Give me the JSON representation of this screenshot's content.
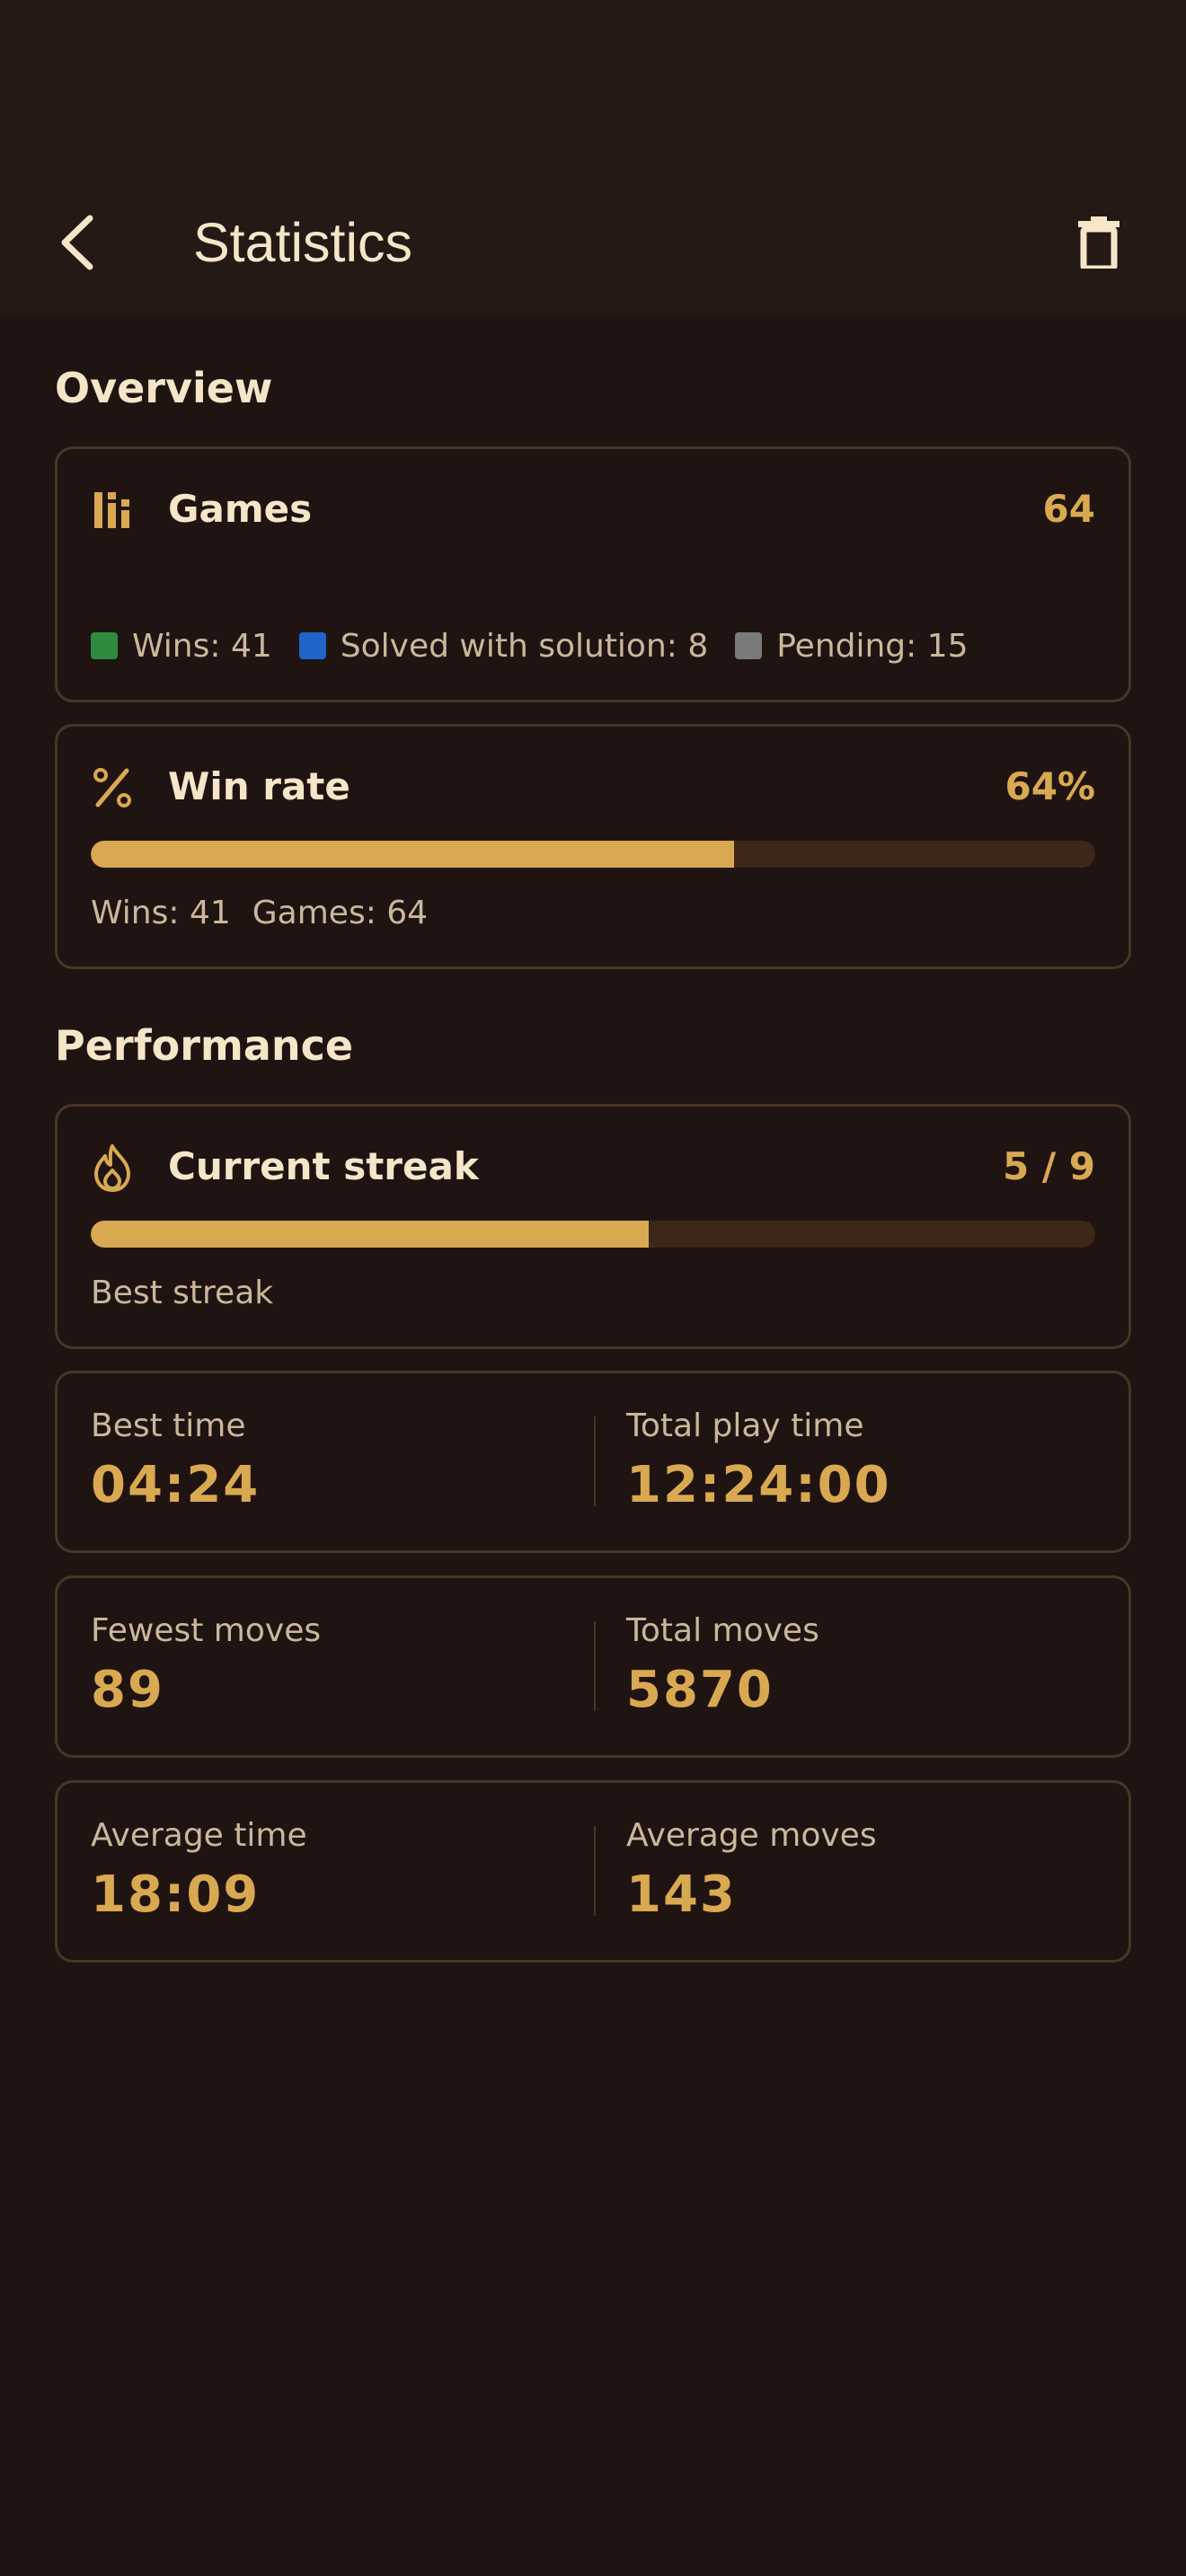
{
  "header": {
    "title": "Statistics",
    "back_icon": "chevron-left-icon",
    "trash_icon": "trash-icon"
  },
  "colors": {
    "background": "#1f1411",
    "accent": "#d9a951",
    "wins": "#2e8b3e",
    "solved": "#1f64c8",
    "pending": "#7a7a7a"
  },
  "overview": {
    "title": "Overview",
    "games": {
      "label": "Games",
      "value": "64",
      "icon": "bar-stats-icon",
      "legend": [
        {
          "label": "Wins: 41",
          "color": "#2e8b3e"
        },
        {
          "label": "Solved with solution: 8",
          "color": "#1f64c8"
        },
        {
          "label": "Pending: 15",
          "color": "#7a7a7a"
        }
      ]
    },
    "win_rate": {
      "label": "Win rate",
      "value": "64%",
      "icon": "percent-icon",
      "progress": 0.64,
      "wins_text": "Wins: 41",
      "games_text": "Games: 64"
    }
  },
  "performance": {
    "title": "Performance",
    "streak": {
      "label": "Current streak",
      "value": "5 / 9",
      "icon": "flame-icon",
      "progress": 0.5556,
      "sub_label": "Best streak"
    },
    "stats": [
      {
        "left_label": "Best time",
        "left_value": "04:24",
        "right_label": "Total play time",
        "right_value": "12:24:00"
      },
      {
        "left_label": "Fewest moves",
        "left_value": "89",
        "right_label": "Total moves",
        "right_value": "5870"
      },
      {
        "left_label": "Average time",
        "left_value": "18:09",
        "right_label": "Average moves",
        "right_value": "143"
      }
    ]
  }
}
